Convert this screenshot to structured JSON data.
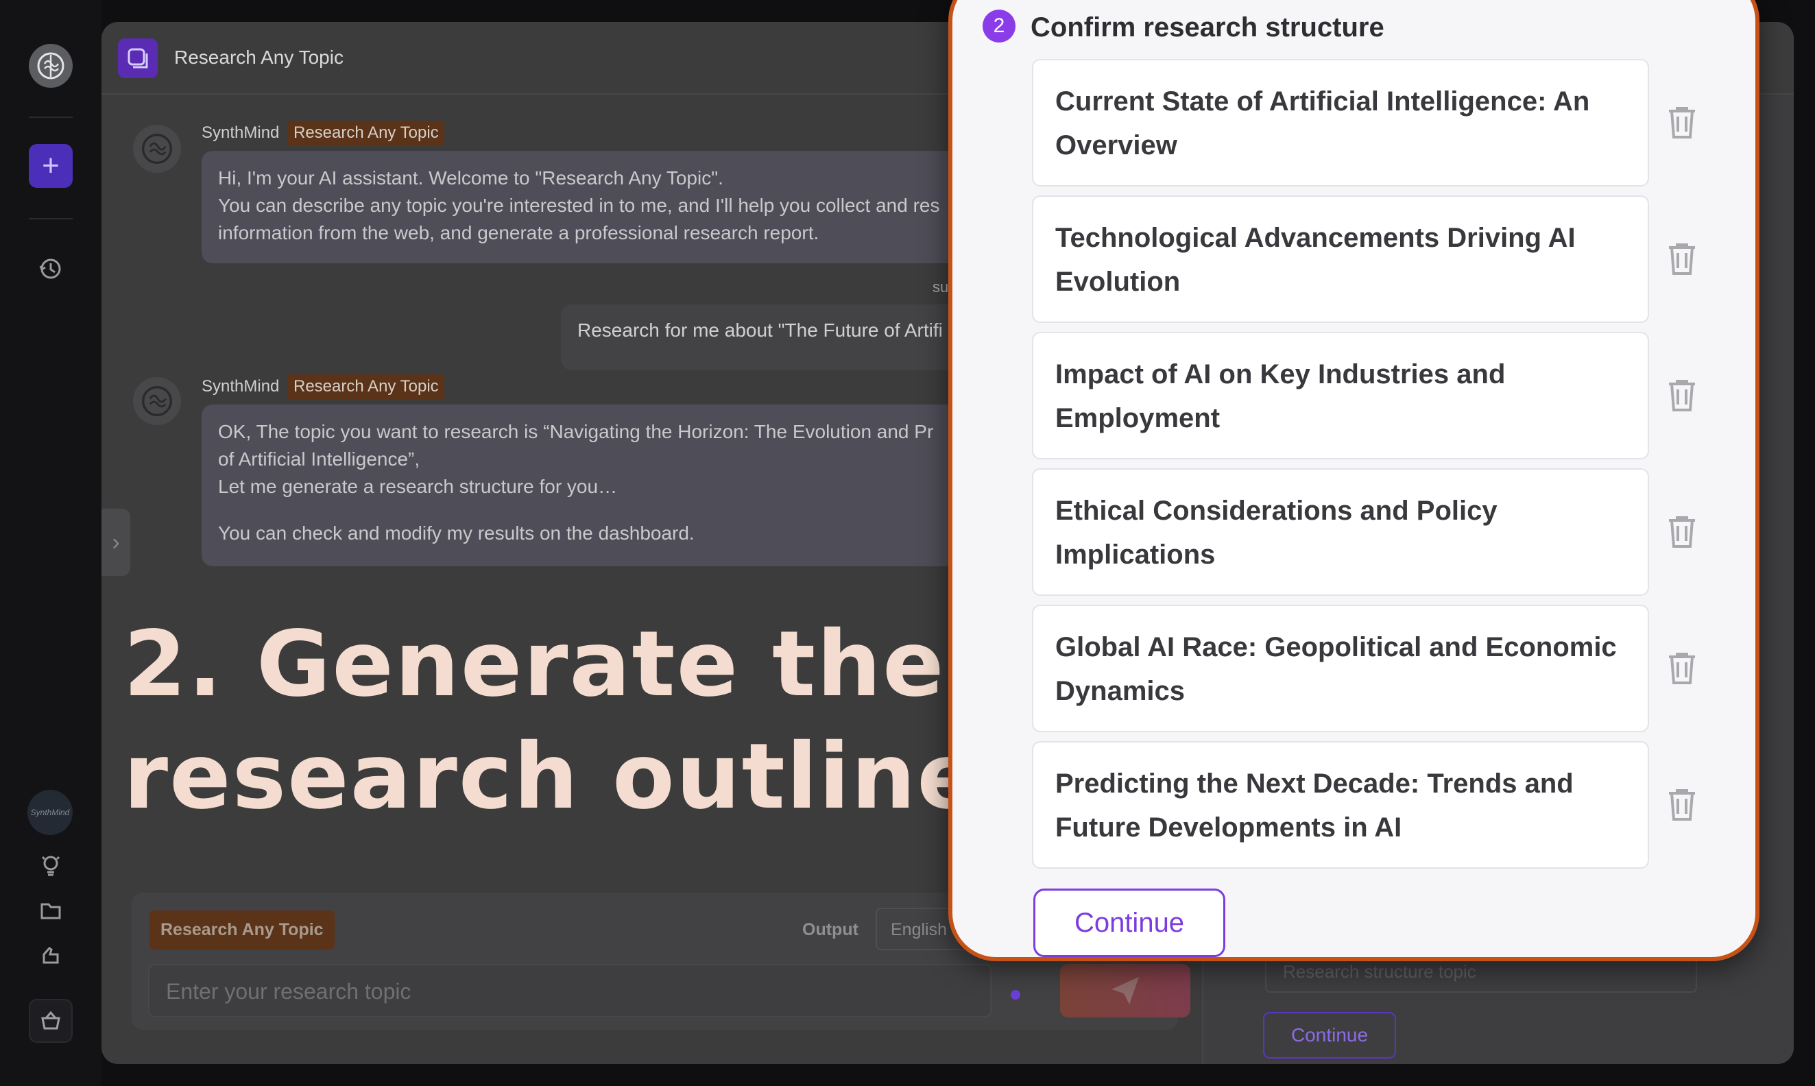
{
  "app": {
    "title": "Research Any Topic",
    "brand_color": "#5a2bb3",
    "accent_color": "#7b3ce0"
  },
  "rail": {
    "avatar_text": "SynthMind",
    "icons": [
      "brain-logo-icon",
      "plus-icon",
      "history-icon",
      "lightbulb-icon",
      "folder-icon",
      "hand-icon",
      "basket-icon"
    ]
  },
  "chat": {
    "messages": [
      {
        "sender": "SynthMind",
        "tag": "Research Any Topic",
        "lines": [
          "Hi, I'm your AI assistant. Welcome to \"Research Any Topic\".",
          "You can describe any topic you're interested in to me, and I'll help you collect and res",
          "information from the web, and generate a professional research report."
        ]
      },
      {
        "user_label": "su",
        "text": "Research for me about \"The Future of Artifi"
      },
      {
        "sender": "SynthMind",
        "tag": "Research Any Topic",
        "lines": [
          "OK, The topic you want to research is “Navigating the Horizon: The Evolution and Pr",
          "of Artificial Intelligence”,",
          "Let me generate a research structure for you…",
          "You can check and modify my results on the dashboard."
        ]
      }
    ]
  },
  "caption": {
    "line1": "2. Generate the",
    "line2": "research outline."
  },
  "input": {
    "tag": "Research Any Topic",
    "output_label": "Output",
    "language": "English",
    "placeholder": "Enter your research topic"
  },
  "dashboard": {
    "topic_placeholder": "Research structure topic",
    "continue_label": "Continue"
  },
  "modal": {
    "step_number": "2",
    "step_title": "Confirm research structure",
    "sections": [
      "Current State of Artificial Intelligence: An Overview",
      "Technological Advancements Driving AI Evolution",
      "Impact of AI on Key Industries and Employment",
      "Ethical Considerations and Policy Implications",
      "Global AI Race: Geopolitical and Economic Dynamics",
      "Predicting the Next Decade: Trends and Future Developments in AI"
    ],
    "continue_label": "Continue"
  }
}
